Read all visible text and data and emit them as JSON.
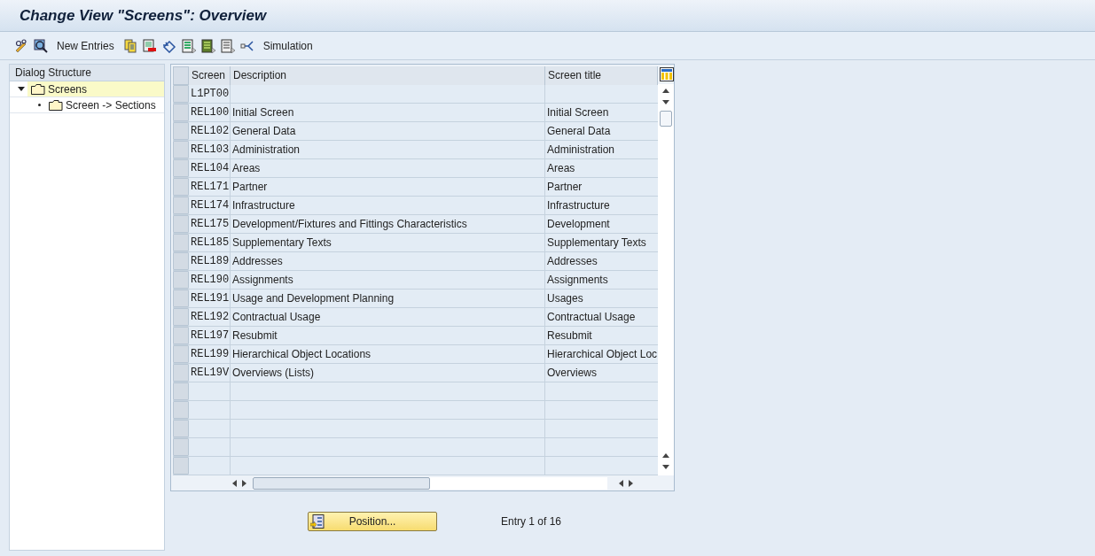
{
  "window": {
    "title": "Change View \"Screens\": Overview"
  },
  "toolbar": {
    "buttons": [
      "New Entries",
      "Simulation"
    ]
  },
  "sidebar": {
    "title": "Dialog Structure",
    "tree": [
      {
        "label": "Screens",
        "selected": true,
        "expanded": true,
        "children": [
          {
            "label": "Screen -> Sections",
            "selected": false
          }
        ]
      }
    ]
  },
  "table": {
    "columns": [
      "Screen",
      "Description",
      "Screen title"
    ],
    "rows": [
      {
        "screen": "L1PT00",
        "description": "",
        "title": ""
      },
      {
        "screen": "REL100",
        "description": "Initial Screen",
        "title": "Initial Screen"
      },
      {
        "screen": "REL102",
        "description": "General Data",
        "title": "General Data"
      },
      {
        "screen": "REL103",
        "description": "Administration",
        "title": "Administration"
      },
      {
        "screen": "REL104",
        "description": "Areas",
        "title": "Areas"
      },
      {
        "screen": "REL171",
        "description": "Partner",
        "title": "Partner"
      },
      {
        "screen": "REL174",
        "description": "Infrastructure",
        "title": "Infrastructure"
      },
      {
        "screen": "REL175",
        "description": "Development/Fixtures and Fittings Characteristics",
        "title": "Development"
      },
      {
        "screen": "REL185",
        "description": "Supplementary Texts",
        "title": "Supplementary Texts"
      },
      {
        "screen": "REL189",
        "description": "Addresses",
        "title": "Addresses"
      },
      {
        "screen": "REL190",
        "description": "Assignments",
        "title": "Assignments"
      },
      {
        "screen": "REL191",
        "description": "Usage and Development Planning",
        "title": "Usages"
      },
      {
        "screen": "REL192",
        "description": "Contractual Usage",
        "title": "Contractual Usage"
      },
      {
        "screen": "REL197",
        "description": "Resubmit",
        "title": "Resubmit"
      },
      {
        "screen": "REL199",
        "description": "Hierarchical Object Locations",
        "title": "Hierarchical Object Loc"
      },
      {
        "screen": "REL19V",
        "description": "Overviews (Lists)",
        "title": "Overviews"
      }
    ]
  },
  "footer": {
    "button": "Position...",
    "entry": "Entry 1 of 16"
  }
}
